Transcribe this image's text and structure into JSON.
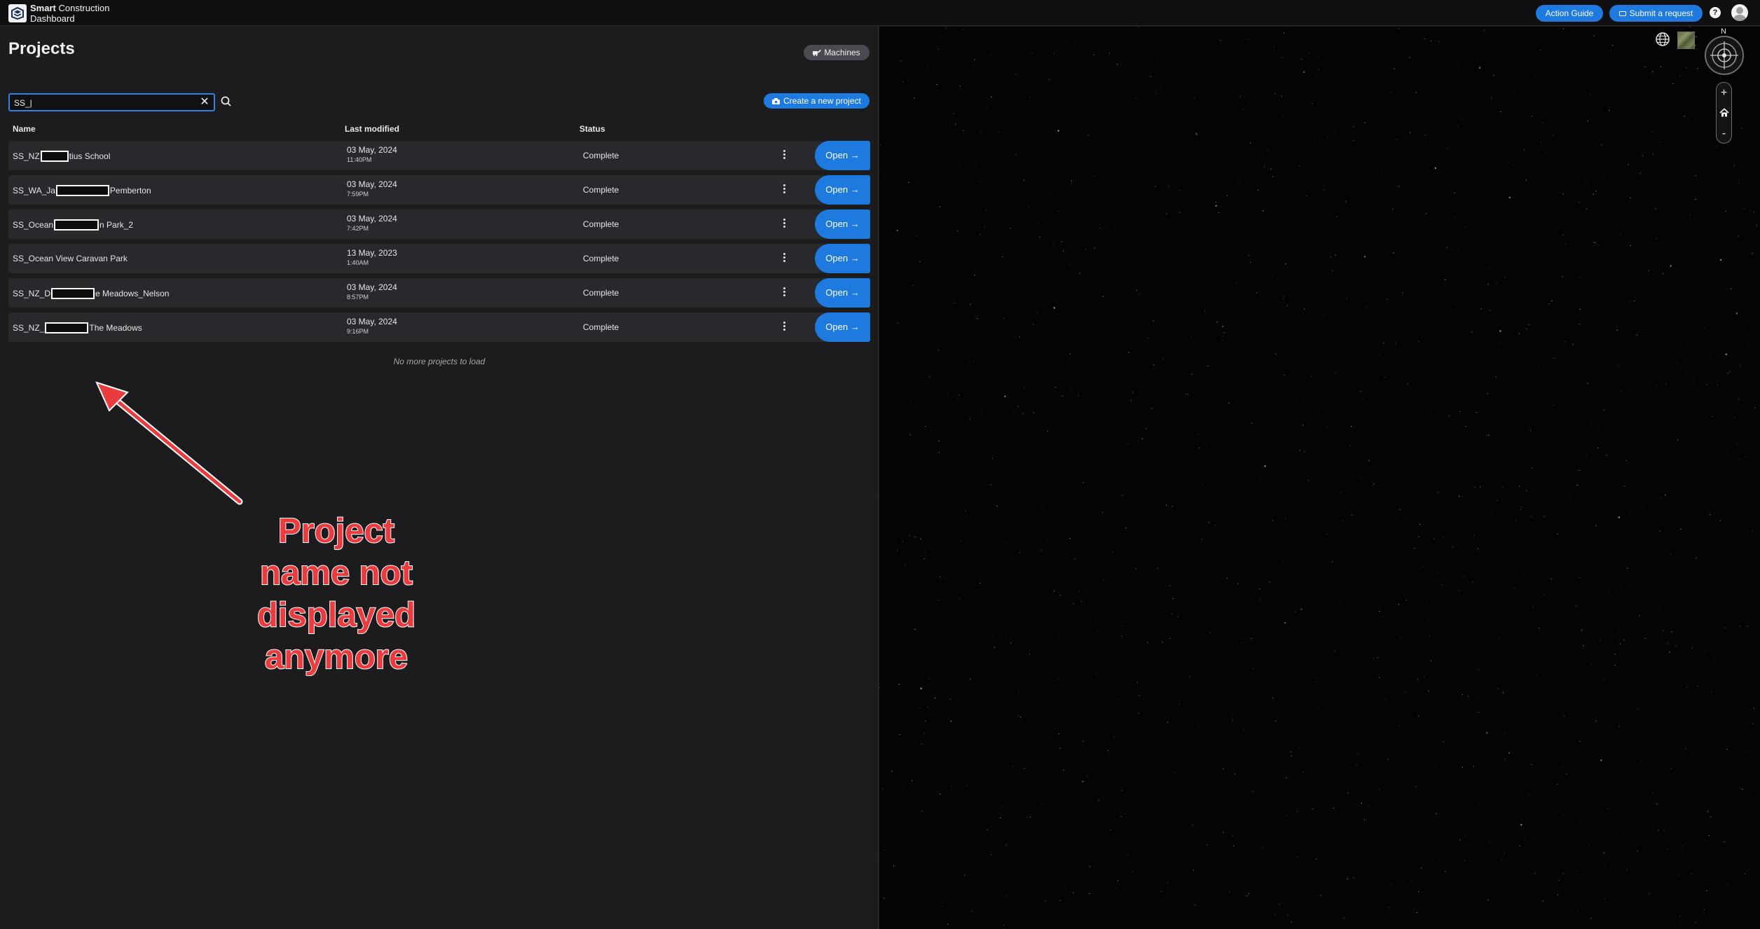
{
  "header": {
    "brand_bold": "Smart",
    "brand_rest": " Construction",
    "brand_line2": "Dashboard",
    "action_guide": "Action Guide",
    "submit_request": "Submit a request",
    "help_label": "?"
  },
  "projects": {
    "title": "Projects",
    "machines_button": "Machines",
    "search_value": "SS_|",
    "create_button": "Create a new project",
    "columns": {
      "name": "Name",
      "last_modified": "Last modified",
      "status": "Status"
    },
    "open_label": "Open →",
    "rows": [
      {
        "name_prefix": "SS_NZ",
        "name_suffix": "tius School",
        "date": "03 May, 2024",
        "time": "11:40PM",
        "status": "Complete"
      },
      {
        "name_prefix": "SS_WA_Ja",
        "name_suffix": "Pemberton",
        "date": "03 May, 2024",
        "time": "7:59PM",
        "status": "Complete"
      },
      {
        "name_prefix": "SS_Ocean",
        "name_suffix": "n Park_2",
        "date": "03 May, 2024",
        "time": "7:42PM",
        "status": "Complete"
      },
      {
        "name_prefix": "SS_Ocean View Caravan Park",
        "name_suffix": "",
        "date": "13 May, 2023",
        "time": "1:40AM",
        "status": "Complete"
      },
      {
        "name_prefix": "SS_NZ_D",
        "name_suffix": "e Meadows_Nelson",
        "date": "03 May, 2024",
        "time": "8:57PM",
        "status": "Complete"
      },
      {
        "name_prefix": "SS_NZ_",
        "name_suffix": "The Meadows",
        "date": "03 May, 2024",
        "time": "9:16PM",
        "status": "Complete"
      }
    ],
    "no_more": "No more projects to load"
  },
  "annotation": {
    "line1": "Project",
    "line2": "name not",
    "line3": "displayed",
    "line4": "anymore",
    "color": "#ea3b3f"
  },
  "map_controls": {
    "north": "N",
    "zoom_in": "+",
    "zoom_out": "-"
  },
  "colors": {
    "accent": "#1f7ae0",
    "panel": "#1c1c1f",
    "row": "#29292d"
  }
}
